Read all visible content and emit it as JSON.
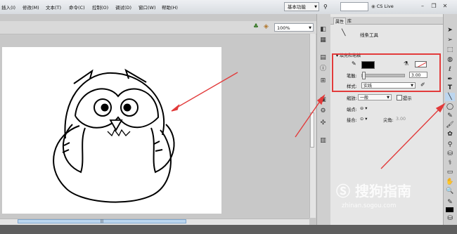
{
  "menu": {
    "items": [
      "插入(I)",
      "修改(M)",
      "文本(T)",
      "命令(C)",
      "控制(O)",
      "调试(D)",
      "窗口(W)",
      "帮助(H)"
    ],
    "workspace": "基本功能",
    "cs_live": "CS Live"
  },
  "stage": {
    "zoom": "100%"
  },
  "properties": {
    "tabs": [
      "属性",
      "库"
    ],
    "tool_name": "线条工具",
    "section_fill_stroke": "填充和笔触",
    "stroke_label": "笔触:",
    "stroke_value": "3.00",
    "style_label": "样式:",
    "style_value": "实线",
    "scale_label": "缩放:",
    "scale_value": "一般",
    "hint_label": "提示",
    "cap_label": "端点:",
    "join_label": "接合:",
    "miter_label": "尖角:",
    "miter_value": "3.00"
  },
  "watermark": {
    "logo": "搜狗指南",
    "url": "zhinan.sogou.com"
  },
  "colors": {
    "highlight": "#e23b3b",
    "stroke": "#000000"
  }
}
